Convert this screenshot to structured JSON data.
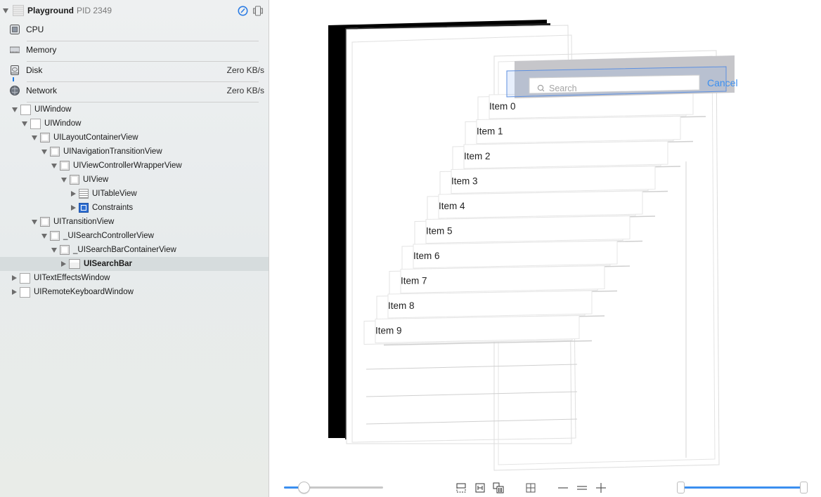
{
  "process": {
    "name": "Playground",
    "pid_label": "PID 2349"
  },
  "header_icons": [
    "debug-gauge-icon",
    "device-icon"
  ],
  "gauges": [
    {
      "label": "CPU",
      "value": "",
      "icon": "cpu-icon"
    },
    {
      "label": "Memory",
      "value": "",
      "icon": "memory-icon"
    },
    {
      "label": "Disk",
      "value": "Zero KB/s",
      "icon": "disk-icon"
    },
    {
      "label": "Network",
      "value": "Zero KB/s",
      "icon": "network-icon"
    }
  ],
  "tree": [
    {
      "label": "UIWindow",
      "depth": 0,
      "expanded": true,
      "icon": "window"
    },
    {
      "label": "UIWindow",
      "depth": 1,
      "expanded": true,
      "icon": "window"
    },
    {
      "label": "UILayoutContainerView",
      "depth": 2,
      "expanded": true,
      "icon": "view"
    },
    {
      "label": "UINavigationTransitionView",
      "depth": 3,
      "expanded": true,
      "icon": "view"
    },
    {
      "label": "UIViewControllerWrapperView",
      "depth": 4,
      "expanded": true,
      "icon": "view"
    },
    {
      "label": "UIView",
      "depth": 5,
      "expanded": true,
      "icon": "view"
    },
    {
      "label": "UITableView",
      "depth": 6,
      "expanded": false,
      "icon": "table"
    },
    {
      "label": "Constraints",
      "depth": 6,
      "expanded": false,
      "icon": "constraints"
    },
    {
      "label": "UITransitionView",
      "depth": 2,
      "expanded": true,
      "icon": "view"
    },
    {
      "label": "_UISearchControllerView",
      "depth": 3,
      "expanded": true,
      "icon": "view"
    },
    {
      "label": "_UISearchBarContainerView",
      "depth": 4,
      "expanded": true,
      "icon": "view"
    },
    {
      "label": "UISearchBar",
      "depth": 5,
      "expanded": false,
      "icon": "searchbar",
      "selected": true
    },
    {
      "label": "UITextEffectsWindow",
      "depth": 0,
      "expanded": false,
      "icon": "window"
    },
    {
      "label": "UIRemoteKeyboardWindow",
      "depth": 0,
      "expanded": false,
      "icon": "window"
    }
  ],
  "canvas": {
    "search_placeholder": "Search",
    "cancel_label": "Cancel",
    "items": [
      "Item 0",
      "Item 1",
      "Item 2",
      "Item 3",
      "Item 4",
      "Item 5",
      "Item 6",
      "Item 7",
      "Item 8",
      "Item 9"
    ],
    "accent_color": "#3b8ff0"
  },
  "toolbar": {
    "spacing_slider_value": 0.2,
    "range_slider": {
      "min": 0,
      "max": 1
    },
    "buttons": [
      "show-clipped-content-icon",
      "show-constraints-icon",
      "change-view-mode-icon",
      "orientation-icon",
      "zoom-out-icon",
      "zoom-actual-icon",
      "zoom-in-icon"
    ]
  }
}
